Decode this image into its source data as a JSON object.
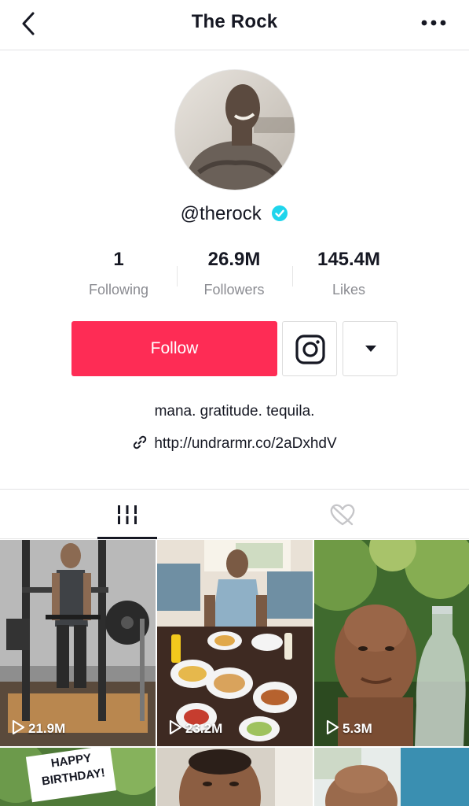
{
  "header": {
    "title": "The Rock",
    "back_icon": "chevron-left-icon",
    "more_icon": "more-horizontal-icon"
  },
  "profile": {
    "handle": "@therock",
    "verified": true,
    "verified_color": "#20d5ec",
    "stats": [
      {
        "value": "1",
        "label": "Following"
      },
      {
        "value": "26.9M",
        "label": "Followers"
      },
      {
        "value": "145.4M",
        "label": "Likes"
      }
    ],
    "follow_label": "Follow",
    "follow_color": "#fe2c55",
    "bio": "mana. gratitude. tequila.",
    "link": "http://undrarmr.co/2aDxhdV"
  },
  "tabs": [
    {
      "icon": "grid-icon",
      "active": true
    },
    {
      "icon": "liked-heart-icon",
      "active": false
    }
  ],
  "videos": [
    {
      "views": "21.9M"
    },
    {
      "views": "23.2M"
    },
    {
      "views": "5.3M"
    },
    {
      "overlay_text": "HAPPY BIRTHDAY!"
    },
    {},
    {}
  ]
}
